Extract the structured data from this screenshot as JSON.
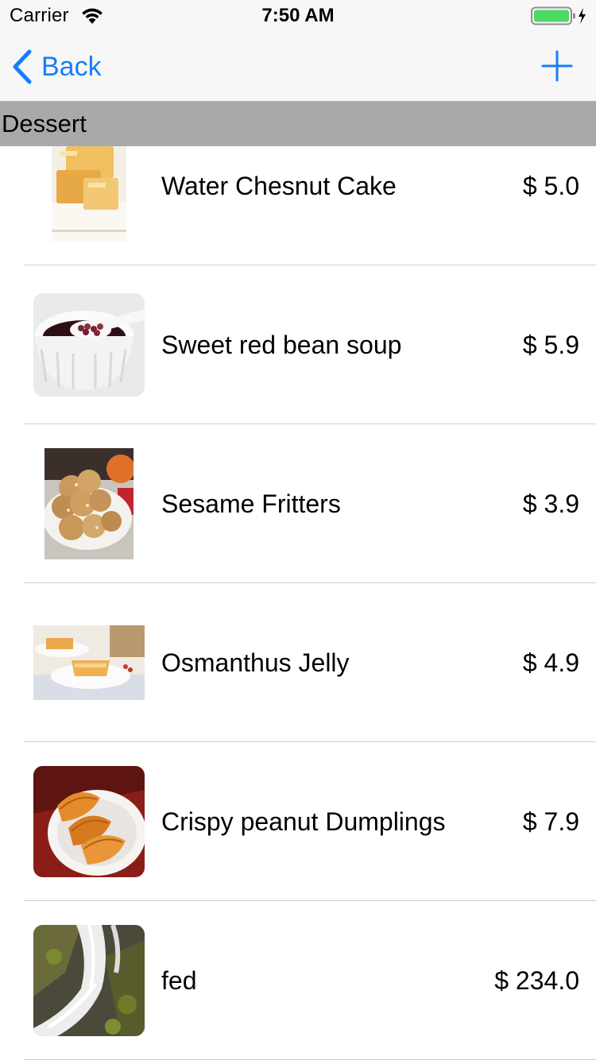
{
  "status_bar": {
    "carrier": "Carrier",
    "time": "7:50 AM",
    "battery_color": "#4cd964"
  },
  "nav": {
    "back_label": "Back",
    "back_icon": "chevron-left-icon",
    "add_icon": "plus-icon",
    "tint_color": "#157efb"
  },
  "section": {
    "title": "Dessert",
    "header_color": "#a9a9a9"
  },
  "items": [
    {
      "name": "Water Chesnut Cake",
      "price": "$ 5.0",
      "image": "water-chestnut-cake-photo"
    },
    {
      "name": "Sweet red bean soup",
      "price": "$ 5.9",
      "image": "red-bean-soup-photo"
    },
    {
      "name": "Sesame Fritters",
      "price": "$ 3.9",
      "image": "sesame-fritters-photo"
    },
    {
      "name": "Osmanthus Jelly",
      "price": "$ 4.9",
      "image": "osmanthus-jelly-photo"
    },
    {
      "name": "Crispy peanut Dumplings",
      "price": "$ 7.9",
      "image": "peanut-dumplings-photo"
    },
    {
      "name": "fed",
      "price": "$ 234.0",
      "image": "waterfall-photo"
    }
  ]
}
